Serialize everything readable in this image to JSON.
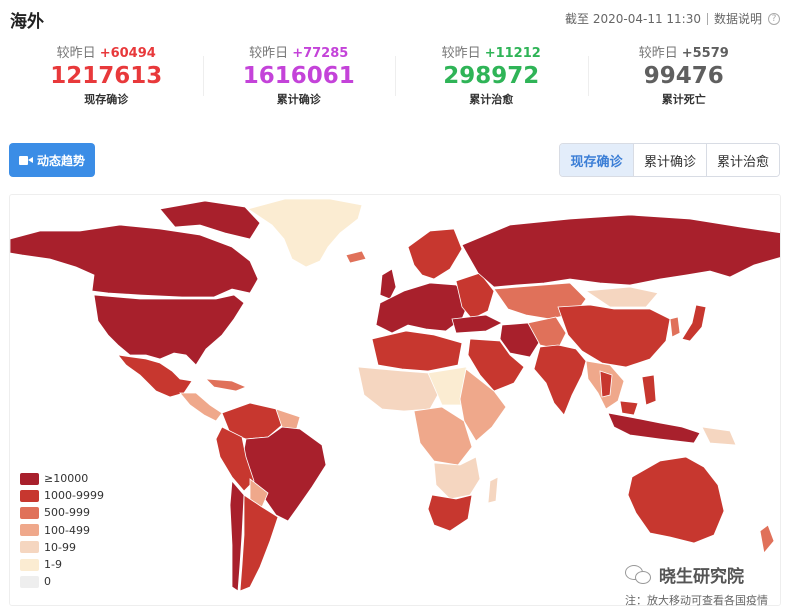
{
  "header": {
    "title": "海外",
    "as_of": "截至 2020-04-11 11:30",
    "explain_label": "数据说明"
  },
  "stats": [
    {
      "delta_label": "较昨日",
      "delta": "+60494",
      "value": "1217613",
      "label": "现存确诊",
      "color": "#e8393b"
    },
    {
      "delta_label": "较昨日",
      "delta": "+77285",
      "value": "1616061",
      "label": "累计确诊",
      "color": "#c443d9"
    },
    {
      "delta_label": "较昨日",
      "delta": "+11212",
      "value": "298972",
      "label": "累计治愈",
      "color": "#2fb457"
    },
    {
      "delta_label": "较昨日",
      "delta": "+5579",
      "value": "99476",
      "label": "累计死亡",
      "color": "#5f5f5f"
    }
  ],
  "trend_button": {
    "label": "动态趋势",
    "icon": "video-camera-icon"
  },
  "tabs": [
    {
      "label": "现存确诊",
      "active": true
    },
    {
      "label": "累计确诊",
      "active": false
    },
    {
      "label": "累计治愈",
      "active": false
    }
  ],
  "legend": [
    {
      "label": "≥10000",
      "color": "#a8202c"
    },
    {
      "label": "1000-9999",
      "color": "#c7372f"
    },
    {
      "label": "500-999",
      "color": "#e0715a"
    },
    {
      "label": "100-499",
      "color": "#efa88b"
    },
    {
      "label": "10-99",
      "color": "#f5d6c0"
    },
    {
      "label": "1-9",
      "color": "#fbecd2"
    },
    {
      "label": "0",
      "color": "#eeeeee"
    }
  ],
  "watermark": {
    "text": "晓生研究院",
    "icon": "wechat-icon"
  },
  "note": "注：放大移动可查看各国疫情"
}
